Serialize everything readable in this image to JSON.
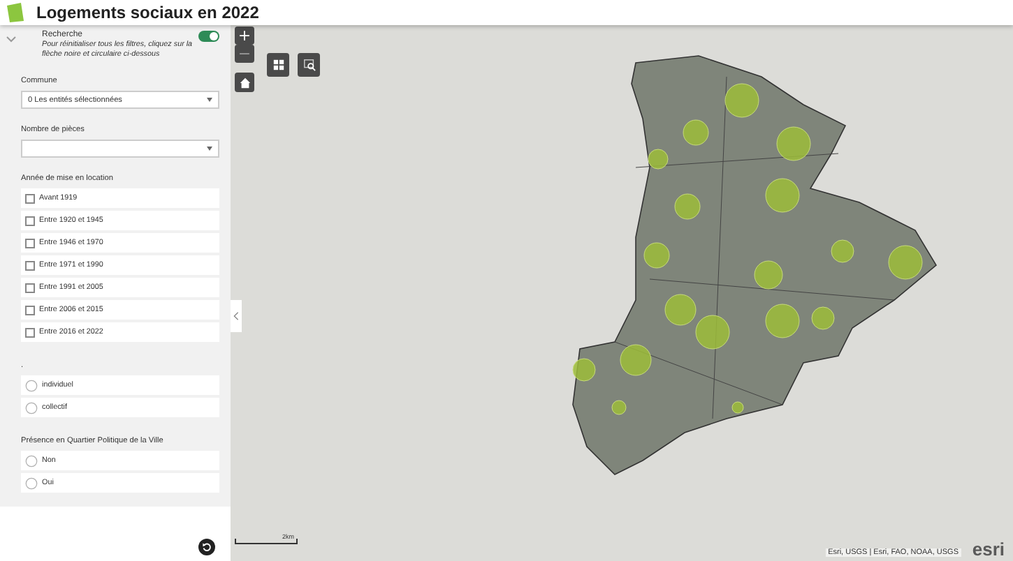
{
  "header": {
    "title": "Logements sociaux en 2022"
  },
  "search": {
    "label": "Recherche",
    "description": "Pour réinitialiser tous les filtres, cliquez sur la flèche noire et circulaire ci-dessous",
    "on": true,
    "expanded": true
  },
  "selects": [
    {
      "label": "Commune",
      "value": "0 Les entités sélectionnées"
    },
    {
      "label": "Nombre de pièces"
    }
  ],
  "year_filter": {
    "label": "Année de mise en location",
    "options": [
      {
        "label": "Avant 1919",
        "checked": false
      },
      {
        "label": "Entre 1920 et 1945",
        "checked": false
      },
      {
        "label": "Entre 1946 et 1970",
        "checked": false
      },
      {
        "label": "Entre 1971 et 1990",
        "checked": false
      },
      {
        "label": "Entre 1991 et 2005",
        "checked": false
      },
      {
        "label": "Entre 2006 et 2015",
        "checked": false
      },
      {
        "label": "Entre 2016 et 2022",
        "checked": false
      }
    ]
  },
  "radio_groups": [
    {
      "label": ".",
      "options": [
        {
          "label": "individuel",
          "selected": false
        },
        {
          "label": "collectif",
          "selected": false
        }
      ]
    },
    {
      "label": "Présence en Quartier Politique de la Ville",
      "options": [
        {
          "label": "Non",
          "selected": false
        },
        {
          "label": "Oui",
          "selected": false
        }
      ]
    }
  ],
  "map": {
    "scale_label": "2km",
    "attribution": "Esri, USGS | Esri, FAO, NOAA, USGS",
    "logo": "esri",
    "zoom_in": "+",
    "zoom_out": "−"
  }
}
